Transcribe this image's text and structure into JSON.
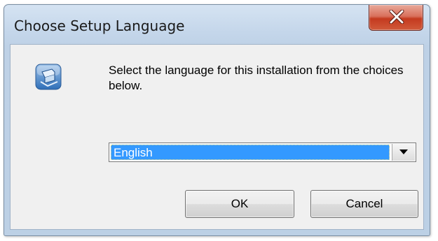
{
  "window": {
    "title": "Choose Setup Language",
    "close_symbol": "X"
  },
  "dialog": {
    "icon": "setup-installer-icon",
    "message": "Select the language for this installation from the choices below."
  },
  "language_select": {
    "selected": "English",
    "arrow_icon": "chevron-down-icon"
  },
  "buttons": {
    "ok_label": "OK",
    "cancel_label": "Cancel"
  },
  "colors": {
    "selection_highlight": "#3399ff",
    "close_button": "#c43a1f",
    "titlebar": "#c4d6ea"
  }
}
